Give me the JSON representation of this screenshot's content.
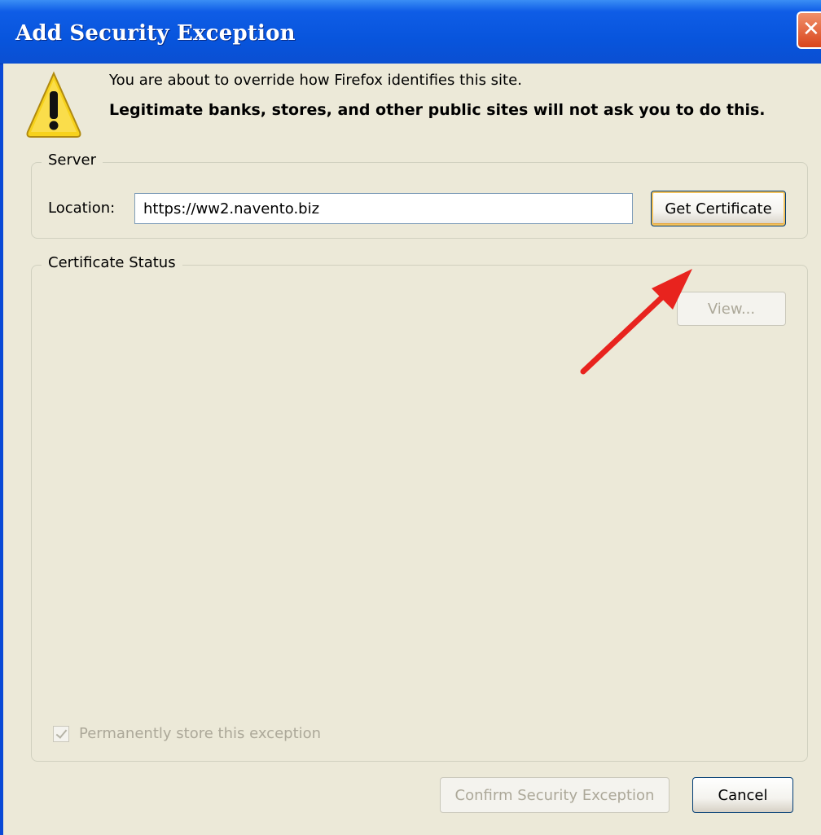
{
  "window": {
    "title": "Add Security Exception",
    "close_glyph": "✕"
  },
  "message": {
    "line1": "You are about to override how Firefox identifies this site.",
    "line2": "Legitimate banks, stores, and other public sites will not ask you to do this."
  },
  "server": {
    "legend": "Server",
    "location_label": "Location:",
    "location_value": "https://ww2.navento.biz",
    "get_certificate_label": "Get Certificate"
  },
  "certificate_status": {
    "legend": "Certificate Status",
    "view_label": "View...",
    "permanent_label": "Permanently store this exception",
    "permanent_checked": true
  },
  "buttons": {
    "confirm_label": "Confirm Security Exception",
    "cancel_label": "Cancel"
  },
  "colors": {
    "titlebar": "#0855dd",
    "dialog_bg": "#ece9d8",
    "annotation_arrow": "#e8231e",
    "warning_yellow": "#f7d21c"
  },
  "icons": {
    "warning": "warning-icon",
    "close": "close-icon",
    "annotation": "red-arrow-annotation"
  }
}
